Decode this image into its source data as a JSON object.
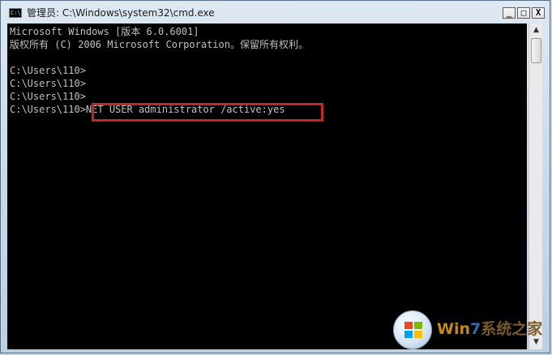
{
  "window": {
    "title": "管理员: C:\\Windows\\system32\\cmd.exe",
    "icon_label": "C:\\",
    "controls": {
      "minimize": "_",
      "maximize": "□",
      "close": "X"
    }
  },
  "console": {
    "lines": [
      "Microsoft Windows [版本 6.0.6001]",
      "版权所有 (C) 2006 Microsoft Corporation。保留所有权利。",
      "",
      "C:\\Users\\110>",
      "C:\\Users\\110>",
      "C:\\Users\\110>",
      "C:\\Users\\110>NET USER administrator /active:yes"
    ],
    "highlighted_command": "NET USER administrator /active:yes"
  },
  "scrollbar": {
    "up_arrow": "▲",
    "down_arrow": "▼"
  },
  "watermark": {
    "brand_part1": "Win",
    "brand_part2": "7",
    "brand_part3": "系统之家"
  },
  "colors": {
    "console_background": "#000000",
    "console_text": "#c0c0c0",
    "highlight_border": "#c0262a"
  },
  "icons": {
    "app": "cmd-icon",
    "logo": "windows-logo-icon"
  }
}
